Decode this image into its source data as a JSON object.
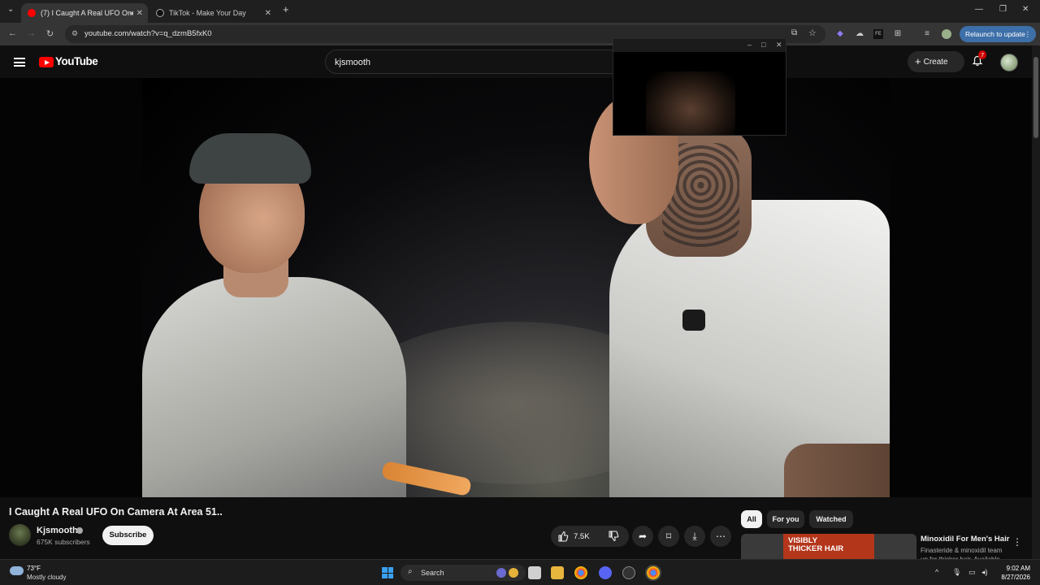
{
  "browser": {
    "tabs": [
      {
        "label": "(7) I Caught A Real UFO On",
        "active": true
      },
      {
        "label": "TikTok - Make Your Day",
        "active": false
      }
    ],
    "new_tab": "+",
    "url": "youtube.com/watch?v=q_dzmB5fxK0",
    "relaunch_label": "Relaunch to update"
  },
  "youtube": {
    "logo_text": "YouTube",
    "search_query": "kjsmooth",
    "create_label": "Create",
    "notification_count": "7"
  },
  "video": {
    "title": "I Caught A Real UFO On Camera At Area 51..",
    "channel_name": "Kjsmooth",
    "subscribers": "675K subscribers",
    "subscribe_label": "Subscribe",
    "like_count": "7.5K"
  },
  "sidebar": {
    "chips": [
      {
        "label": "All",
        "selected": true
      },
      {
        "label": "For you",
        "selected": false
      },
      {
        "label": "Watched",
        "selected": false
      }
    ],
    "ad": {
      "thumb_text": "VISIBLY THICKER HAIR",
      "title": "Minoxidil For Men's Hair",
      "description": "Finasteride & minoxidil team up for thicker hair. Available"
    }
  },
  "taskbar": {
    "temperature": "73°F",
    "condition": "Mostly cloudy",
    "search_label": "Search",
    "time": "9:02 AM",
    "date": "8/27/2026"
  },
  "colors": {
    "accent_red": "#ff0000",
    "background": "#0f0f0f",
    "relaunch_blue": "#3d6fa8"
  }
}
